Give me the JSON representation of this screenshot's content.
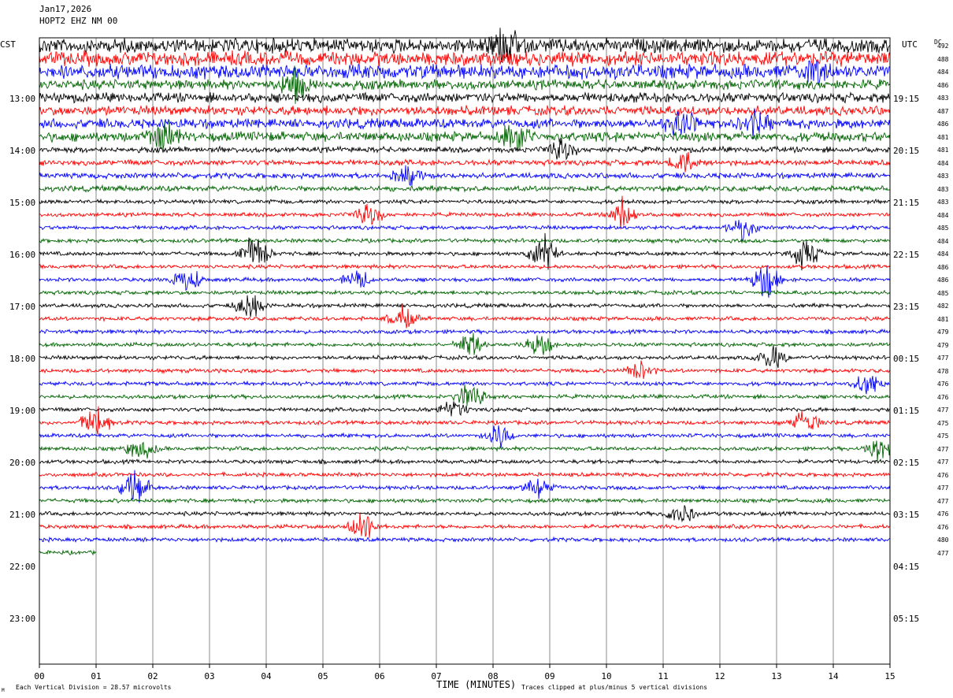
{
  "header": {
    "date": "Jan17,2026",
    "station": "HOPT2 EHZ NM 00",
    "left_zone": "CST",
    "right_zone": "UTC",
    "dc_label": "DC"
  },
  "chart_data": {
    "type": "helicorder",
    "xlabel": "TIME (MINUTES)",
    "xlim": [
      0,
      15
    ],
    "x_ticks": [
      "00",
      "01",
      "02",
      "03",
      "04",
      "05",
      "06",
      "07",
      "08",
      "09",
      "10",
      "11",
      "12",
      "13",
      "14",
      "15"
    ],
    "left_hour_labels": [
      "13:00",
      "14:00",
      "15:00",
      "16:00",
      "17:00",
      "18:00",
      "19:00",
      "20:00",
      "21:00",
      "22:00",
      "23:00"
    ],
    "right_hour_labels": [
      "19:15",
      "20:15",
      "21:15",
      "22:15",
      "23:15",
      "00:15",
      "01:15",
      "02:15",
      "03:15",
      "04:15",
      "05:15"
    ],
    "trace_colors": [
      "#000000",
      "#ff0000",
      "#0000ff",
      "#006400"
    ],
    "dc_offsets": [
      492,
      488,
      484,
      486,
      483,
      487,
      486,
      481,
      481,
      484,
      483,
      483,
      483,
      484,
      485,
      484,
      484,
      486,
      486,
      485,
      482,
      481,
      479,
      479,
      477,
      478,
      476,
      476,
      477,
      475,
      475,
      477,
      477,
      476,
      477,
      477,
      476,
      476,
      480,
      477
    ],
    "last_line_minutes": 1.0,
    "events": [
      {
        "line": 0,
        "minute": 8.2,
        "amp": 3
      },
      {
        "line": 2,
        "minute": 13.7,
        "amp": 1.5
      },
      {
        "line": 3,
        "minute": 4.5,
        "amp": 3
      },
      {
        "line": 7,
        "minute": 2.2,
        "amp": 2.5
      },
      {
        "line": 7,
        "minute": 8.4,
        "amp": 2.5
      },
      {
        "line": 6,
        "minute": 11.3,
        "amp": 2.5
      },
      {
        "line": 6,
        "minute": 12.6,
        "amp": 2
      },
      {
        "line": 8,
        "minute": 9.2,
        "amp": 2
      },
      {
        "line": 9,
        "minute": 11.4,
        "amp": 2
      },
      {
        "line": 10,
        "minute": 6.5,
        "amp": 1.5
      },
      {
        "line": 13,
        "minute": 10.3,
        "amp": 2.5
      },
      {
        "line": 13,
        "minute": 5.8,
        "amp": 2
      },
      {
        "line": 14,
        "minute": 12.4,
        "amp": 2
      },
      {
        "line": 16,
        "minute": 3.8,
        "amp": 3
      },
      {
        "line": 16,
        "minute": 8.9,
        "amp": 3
      },
      {
        "line": 16,
        "minute": 13.5,
        "amp": 2.5
      },
      {
        "line": 18,
        "minute": 12.8,
        "amp": 3
      },
      {
        "line": 18,
        "minute": 2.6,
        "amp": 2
      },
      {
        "line": 18,
        "minute": 5.6,
        "amp": 1.5
      },
      {
        "line": 20,
        "minute": 3.7,
        "amp": 2
      },
      {
        "line": 21,
        "minute": 6.4,
        "amp": 2
      },
      {
        "line": 23,
        "minute": 8.8,
        "amp": 2
      },
      {
        "line": 23,
        "minute": 7.6,
        "amp": 2
      },
      {
        "line": 24,
        "minute": 12.9,
        "amp": 2
      },
      {
        "line": 25,
        "minute": 10.6,
        "amp": 1.5
      },
      {
        "line": 26,
        "minute": 14.6,
        "amp": 2
      },
      {
        "line": 27,
        "minute": 7.6,
        "amp": 2.5
      },
      {
        "line": 28,
        "minute": 7.3,
        "amp": 1.5
      },
      {
        "line": 29,
        "minute": 1.0,
        "amp": 3
      },
      {
        "line": 29,
        "minute": 13.5,
        "amp": 2
      },
      {
        "line": 30,
        "minute": 8.1,
        "amp": 2
      },
      {
        "line": 31,
        "minute": 14.8,
        "amp": 2
      },
      {
        "line": 31,
        "minute": 1.8,
        "amp": 2
      },
      {
        "line": 34,
        "minute": 1.7,
        "amp": 3
      },
      {
        "line": 34,
        "minute": 8.8,
        "amp": 1.5
      },
      {
        "line": 36,
        "minute": 11.3,
        "amp": 2
      },
      {
        "line": 37,
        "minute": 5.7,
        "amp": 2.5
      }
    ]
  },
  "footer": {
    "vertical_division": "Each Vertical Division =   28.57 microvolts",
    "clipping": "Traces clipped at plus/minus 5 vertical divisions",
    "logo_mark": "M"
  }
}
